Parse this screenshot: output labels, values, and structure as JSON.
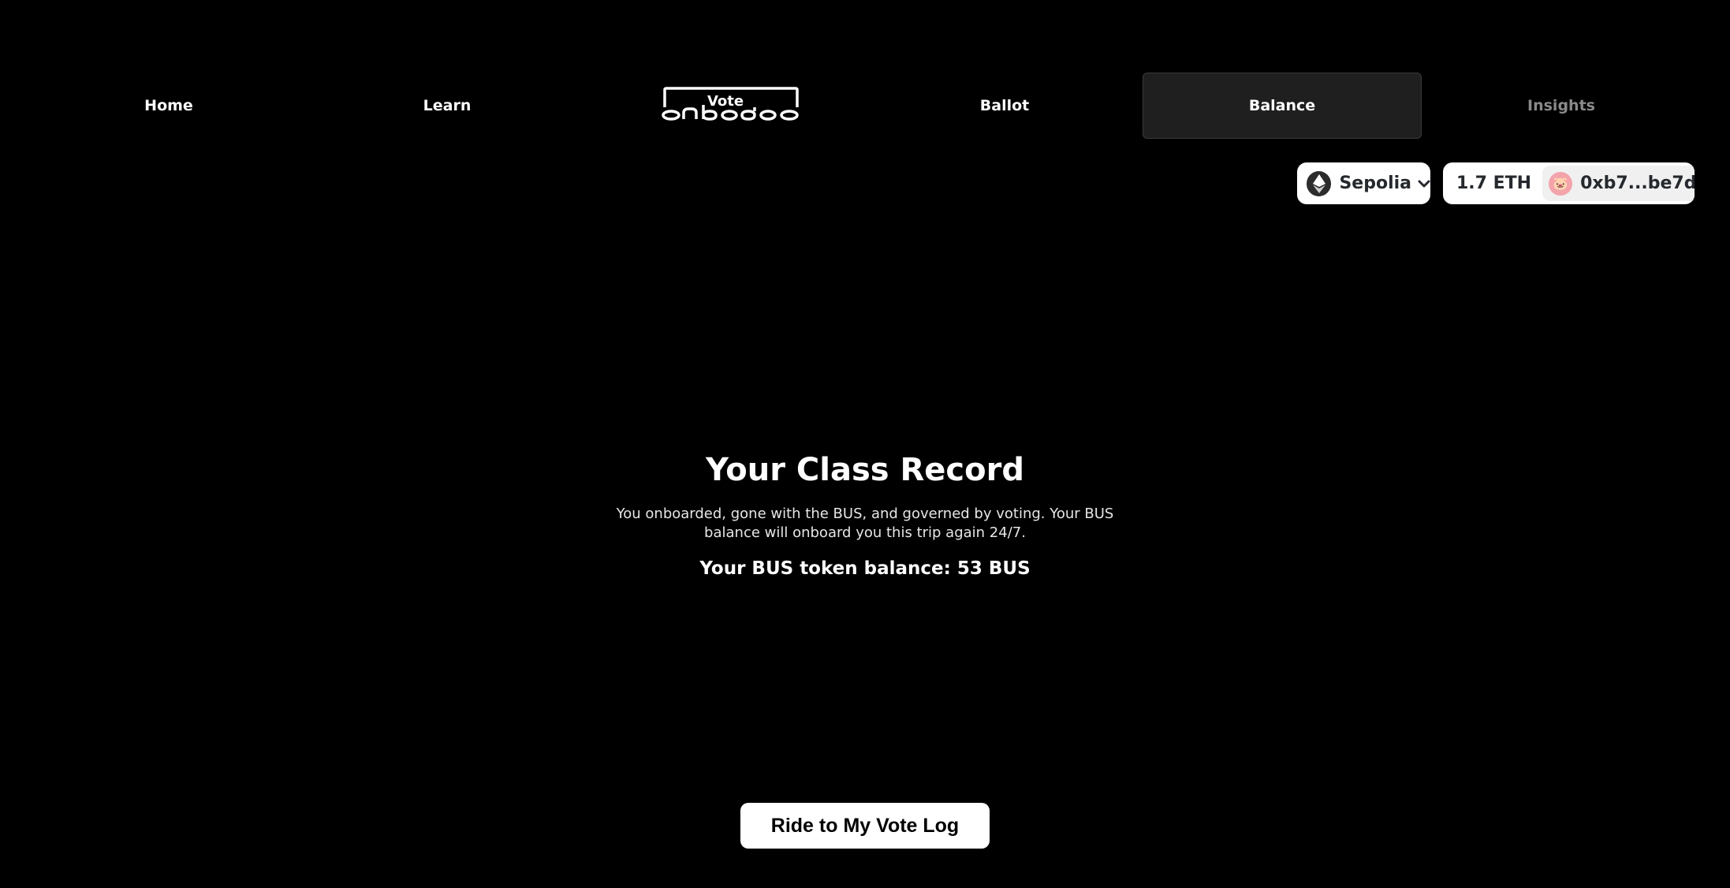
{
  "nav": {
    "items": [
      {
        "label": "Home"
      },
      {
        "label": "Learn"
      },
      {
        "label": "Ballot"
      },
      {
        "label": "Balance"
      },
      {
        "label": "Insights"
      }
    ],
    "logo_text": "Vote"
  },
  "wallet": {
    "network_label": "Sepolia",
    "network_icon": "ethereum-icon",
    "balance": "1.7 ETH",
    "address": "0xb7...be7d",
    "avatar_emoji": "🐷",
    "avatar_color": "#f3a3ab"
  },
  "main": {
    "title": "Your Class Record",
    "description": "You onboarded, gone with the BUS, and governed by voting. Your BUS balance will onboard you this trip again 24/7.",
    "token_balance": "Your BUS token balance: 53 BUS"
  },
  "cta": {
    "label": "Ride to My Vote Log"
  },
  "colors": {
    "background": "#000000",
    "active_tab": "#1f1f1f",
    "button": "#ffffff",
    "dim_text": "#8a8a8a"
  }
}
